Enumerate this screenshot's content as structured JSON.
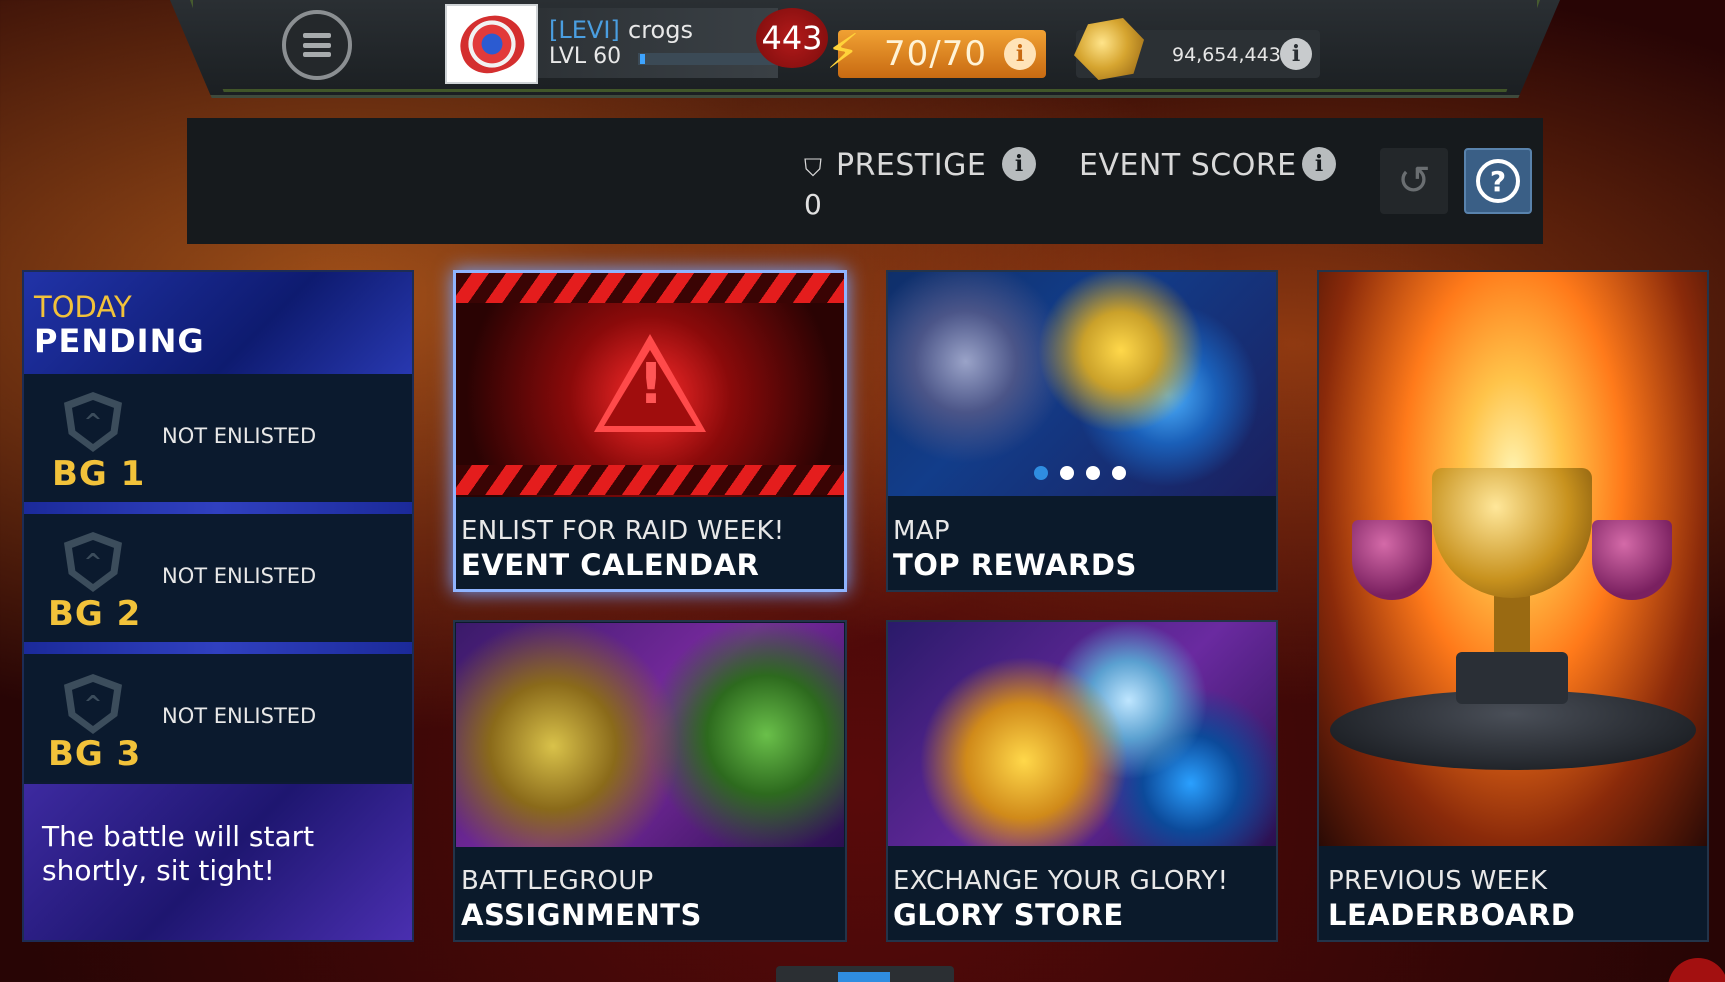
{
  "topbar": {
    "alliance_tag": "[LEVI]",
    "player_name": "crogs",
    "level": "LVL 60",
    "level_progress": 0.04,
    "notification_count": "443",
    "energy": "70/70",
    "gold": "94,654,443",
    "icons": [
      "menu-icon",
      "lightning-icon",
      "gold-icon",
      "info-icon"
    ]
  },
  "score": {
    "prestige_label": "PRESTIGE",
    "prestige_value": "0",
    "event_score_label": "EVENT SCORE"
  },
  "status": {
    "today_label": "TODAY",
    "state": "PENDING",
    "battlegroups": [
      {
        "name": "BG 1",
        "status": "NOT ENLISTED"
      },
      {
        "name": "BG 2",
        "status": "NOT ENLISTED"
      },
      {
        "name": "BG 3",
        "status": "NOT ENLISTED"
      }
    ],
    "message": "The battle will start shortly, sit tight!"
  },
  "cards": {
    "event_calendar": {
      "subtitle": "ENLIST FOR RAID WEEK!",
      "title": "EVENT CALENDAR"
    },
    "top_rewards": {
      "subtitle": "MAP",
      "title": "TOP REWARDS",
      "carousel_pages": 4,
      "carousel_active": 1
    },
    "leaderboard": {
      "subtitle": "PREVIOUS WEEK",
      "title": "LEADERBOARD"
    },
    "assignments": {
      "subtitle": "BATTLEGROUP",
      "title": "ASSIGNMENTS"
    },
    "glory_store": {
      "subtitle": "EXCHANGE YOUR GLORY!",
      "title": "GLORY STORE"
    }
  },
  "colors": {
    "accent_gold": "#f2c23a",
    "accent_blue": "#2f8de0",
    "energy_orange": "#e08a22",
    "warning_red": "#e41d1d"
  }
}
